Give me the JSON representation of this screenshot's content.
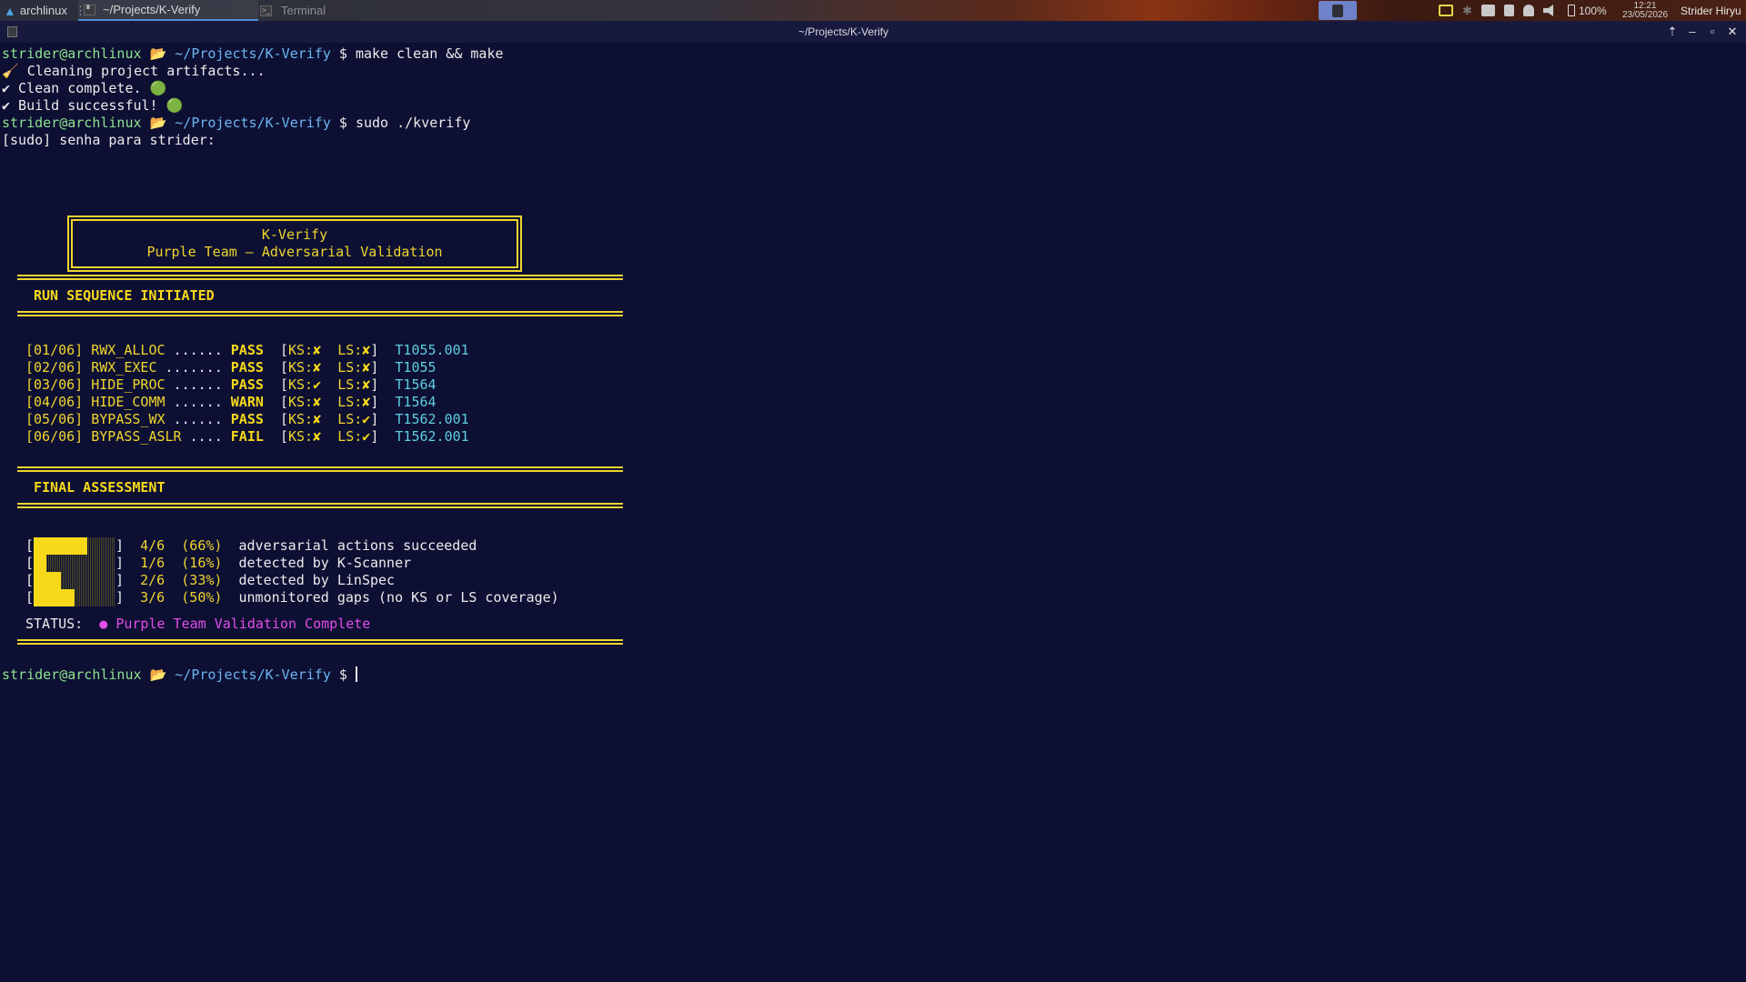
{
  "panel": {
    "distro": "archlinux",
    "active_tab": "~/Projects/K-Verify",
    "inactive_tab": "Terminal",
    "battery": "100%",
    "time": "12:21",
    "date": "23/05/2026",
    "user": "Strider Hiryu"
  },
  "window": {
    "title": "~/Projects/K-Verify"
  },
  "prompt": {
    "user_host": "strider@archlinux",
    "folder_icon": "📂",
    "path": "~/Projects/K-Verify",
    "symbol": "$"
  },
  "session": {
    "cmd1": "make clean && make",
    "out_cleaning": "🧹 Cleaning project artifacts...",
    "out_clean_done": "✔ Clean complete.",
    "out_build_ok": "✔ Build successful!",
    "status_dot": "🟢",
    "cmd2": "sudo ./kverify",
    "sudo_prompt": "[sudo] senha para strider:"
  },
  "banner": {
    "title": "K-Verify",
    "subtitle": "Purple Team – Adversarial Validation"
  },
  "run_header": "RUN SEQUENCE INITIATED",
  "tests": [
    {
      "idx": "[01/06]",
      "name": "RWX_ALLOC",
      "dots": "......",
      "result": "PASS",
      "ks": "✘",
      "ls": "✘",
      "technique": "T1055.001"
    },
    {
      "idx": "[02/06]",
      "name": "RWX_EXEC",
      "dots": ".......",
      "result": "PASS",
      "ks": "✘",
      "ls": "✘",
      "technique": "T1055"
    },
    {
      "idx": "[03/06]",
      "name": "HIDE_PROC",
      "dots": "......",
      "result": "PASS",
      "ks": "✔",
      "ls": "✘",
      "technique": "T1564"
    },
    {
      "idx": "[04/06]",
      "name": "HIDE_COMM",
      "dots": "......",
      "result": "WARN",
      "ks": "✘",
      "ls": "✘",
      "technique": "T1564"
    },
    {
      "idx": "[05/06]",
      "name": "BYPASS_WX",
      "dots": "......",
      "result": "PASS",
      "ks": "✘",
      "ls": "✔",
      "technique": "T1562.001"
    },
    {
      "idx": "[06/06]",
      "name": "BYPASS_ASLR",
      "dots": "....",
      "result": "FAIL",
      "ks": "✘",
      "ls": "✔",
      "technique": "T1562.001"
    }
  ],
  "ks_label": "KS:",
  "ls_label": "LS:",
  "final_header": "FINAL ASSESSMENT",
  "assessment": [
    {
      "fraction": 0.66,
      "ratio": "4/6",
      "pct": "(66%)",
      "desc": "adversarial actions succeeded"
    },
    {
      "fraction": 0.16,
      "ratio": "1/6",
      "pct": "(16%)",
      "desc": "detected by K-Scanner"
    },
    {
      "fraction": 0.33,
      "ratio": "2/6",
      "pct": "(33%)",
      "desc": "detected by LinSpec"
    },
    {
      "fraction": 0.5,
      "ratio": "3/6",
      "pct": "(50%)",
      "desc": "unmonitored gaps (no KS or LS coverage)"
    }
  ],
  "status": {
    "label": "STATUS:",
    "dot": "●",
    "text": "Purple Team Validation Complete"
  },
  "colors": {
    "background": "#0d0f33",
    "accent_yellow": "#f0d52e",
    "cyan": "#5ecfe0",
    "magenta": "#e24ee8",
    "green": "#8ee28e",
    "blue": "#6cb6f2"
  }
}
